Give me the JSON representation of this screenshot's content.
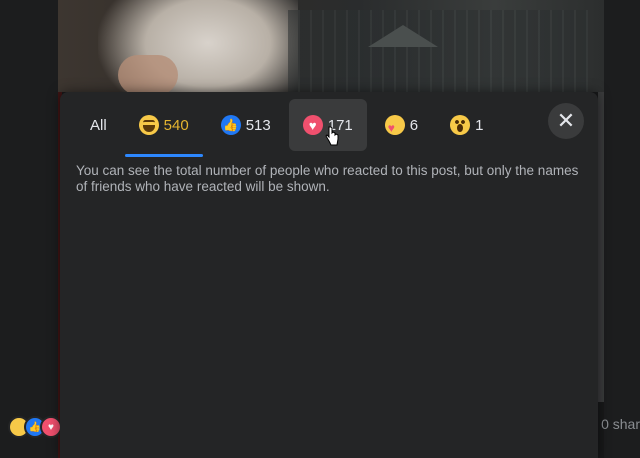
{
  "tabs": [
    {
      "label": "All"
    },
    {
      "count": "540",
      "icon": "haha-icon"
    },
    {
      "count": "513",
      "icon": "like-icon"
    },
    {
      "count": "171",
      "icon": "love-icon"
    },
    {
      "count": "6",
      "icon": "care-icon"
    },
    {
      "count": "1",
      "icon": "wow-icon"
    }
  ],
  "info_text": "You can see the total number of people who reacted to this post, but only the names of friends who have reacted will be shown.",
  "feed": {
    "shares_text": "0 shar"
  },
  "colors": {
    "accent": "#2d88ff",
    "haha_count": "#e4b430",
    "modal_bg": "#242526"
  }
}
